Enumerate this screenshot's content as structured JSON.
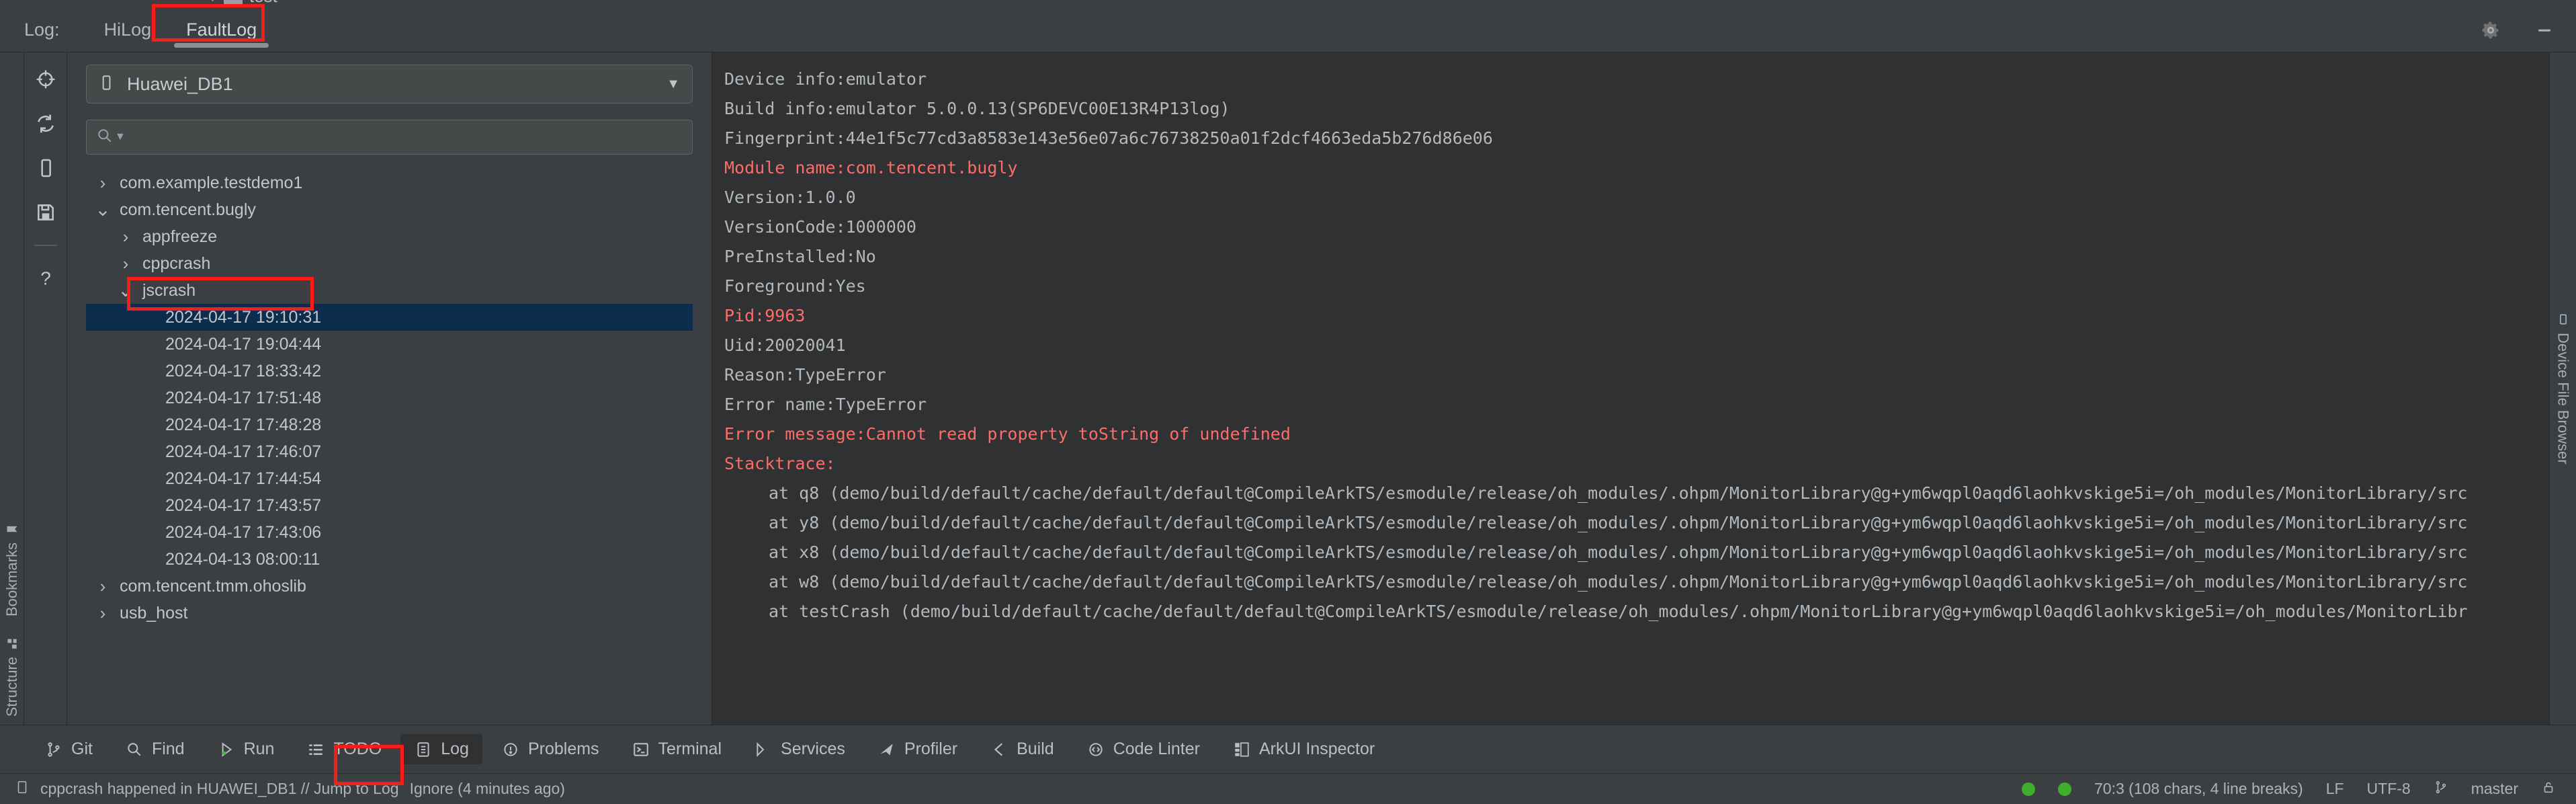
{
  "window": {
    "editor_tab_remnant": "test"
  },
  "log_header": {
    "label": "Log:",
    "tabs": [
      {
        "label": "HiLog",
        "active": false
      },
      {
        "label": "FaultLog",
        "active": true
      }
    ],
    "icons": {
      "settings": "gear-icon",
      "minimize": "minimize-icon"
    }
  },
  "left_rail": {
    "items": [
      {
        "label": "Bookmarks",
        "icon": "bookmark-icon"
      },
      {
        "label": "Structure",
        "icon": "structure-icon"
      }
    ]
  },
  "right_rail": {
    "items": [
      {
        "label": "Device File Browser",
        "icon": "device-icon"
      }
    ]
  },
  "tool_column": {
    "icons": [
      "crosshair-icon",
      "refresh-icon",
      "phone-icon",
      "save-icon",
      "help-icon"
    ]
  },
  "tree_panel": {
    "device": {
      "value": "Huawei_DB1",
      "icon": "phone-icon",
      "caret": "chevron-down-icon"
    },
    "search": {
      "value": "",
      "placeholder": "",
      "icon": "search-icon"
    },
    "rows": [
      {
        "label": "com.example.testdemo1",
        "depth": 0,
        "twisty": "collapsed",
        "selected": false
      },
      {
        "label": "com.tencent.bugly",
        "depth": 0,
        "twisty": "expanded",
        "selected": false
      },
      {
        "label": "appfreeze",
        "depth": 1,
        "twisty": "collapsed",
        "selected": false
      },
      {
        "label": "cppcrash",
        "depth": 1,
        "twisty": "collapsed",
        "selected": false
      },
      {
        "label": "jscrash",
        "depth": 1,
        "twisty": "expanded",
        "selected": false
      },
      {
        "label": "2024-04-17 19:10:31",
        "depth": 2,
        "twisty": "none",
        "selected": true
      },
      {
        "label": "2024-04-17 19:04:44",
        "depth": 2,
        "twisty": "none",
        "selected": false
      },
      {
        "label": "2024-04-17 18:33:42",
        "depth": 2,
        "twisty": "none",
        "selected": false
      },
      {
        "label": "2024-04-17 17:51:48",
        "depth": 2,
        "twisty": "none",
        "selected": false
      },
      {
        "label": "2024-04-17 17:48:28",
        "depth": 2,
        "twisty": "none",
        "selected": false
      },
      {
        "label": "2024-04-17 17:46:07",
        "depth": 2,
        "twisty": "none",
        "selected": false
      },
      {
        "label": "2024-04-17 17:44:54",
        "depth": 2,
        "twisty": "none",
        "selected": false
      },
      {
        "label": "2024-04-17 17:43:57",
        "depth": 2,
        "twisty": "none",
        "selected": false
      },
      {
        "label": "2024-04-17 17:43:06",
        "depth": 2,
        "twisty": "none",
        "selected": false
      },
      {
        "label": "2024-04-13 08:00:11",
        "depth": 2,
        "twisty": "none",
        "selected": false
      },
      {
        "label": "com.tencent.tmm.ohoslib",
        "depth": 0,
        "twisty": "collapsed",
        "selected": false
      },
      {
        "label": "usb_host",
        "depth": 0,
        "twisty": "collapsed",
        "selected": false
      }
    ]
  },
  "log_view": {
    "lines": [
      {
        "text": "Device info:emulator",
        "error": false,
        "indent": false
      },
      {
        "text": "Build info:emulator 5.0.0.13(SP6DEVC00E13R4P13log)",
        "error": false,
        "indent": false
      },
      {
        "text": "Fingerprint:44e1f5c77cd3a8583e143e56e07a6c76738250a01f2dcf4663eda5b276d86e06",
        "error": false,
        "indent": false
      },
      {
        "text": "Module name:com.tencent.bugly",
        "error": true,
        "indent": false
      },
      {
        "text": "Version:1.0.0",
        "error": false,
        "indent": false
      },
      {
        "text": "VersionCode:1000000",
        "error": false,
        "indent": false
      },
      {
        "text": "PreInstalled:No",
        "error": false,
        "indent": false
      },
      {
        "text": "Foreground:Yes",
        "error": false,
        "indent": false
      },
      {
        "text": "Pid:9963",
        "error": true,
        "indent": false
      },
      {
        "text": "Uid:20020041",
        "error": false,
        "indent": false
      },
      {
        "text": "Reason:TypeError",
        "error": false,
        "indent": false
      },
      {
        "text": "Error name:TypeError",
        "error": false,
        "indent": false
      },
      {
        "text": "Error message:Cannot read property toString of undefined",
        "error": true,
        "indent": false
      },
      {
        "text": "Stacktrace:",
        "error": true,
        "indent": false
      },
      {
        "text": "at q8 (demo/build/default/cache/default/default@CompileArkTS/esmodule/release/oh_modules/.ohpm/MonitorLibrary@g+ym6wqpl0aqd6laohkvskige5i=/oh_modules/MonitorLibrary/src",
        "error": false,
        "indent": true
      },
      {
        "text": "at y8 (demo/build/default/cache/default/default@CompileArkTS/esmodule/release/oh_modules/.ohpm/MonitorLibrary@g+ym6wqpl0aqd6laohkvskige5i=/oh_modules/MonitorLibrary/src",
        "error": false,
        "indent": true
      },
      {
        "text": "at x8 (demo/build/default/cache/default/default@CompileArkTS/esmodule/release/oh_modules/.ohpm/MonitorLibrary@g+ym6wqpl0aqd6laohkvskige5i=/oh_modules/MonitorLibrary/src",
        "error": false,
        "indent": true
      },
      {
        "text": "at w8 (demo/build/default/cache/default/default@CompileArkTS/esmodule/release/oh_modules/.ohpm/MonitorLibrary@g+ym6wqpl0aqd6laohkvskige5i=/oh_modules/MonitorLibrary/src",
        "error": false,
        "indent": true
      },
      {
        "text": "at testCrash (demo/build/default/cache/default/default@CompileArkTS/esmodule/release/oh_modules/.ohpm/MonitorLibrary@g+ym6wqpl0aqd6laohkvskige5i=/oh_modules/MonitorLibr",
        "error": false,
        "indent": true
      }
    ]
  },
  "bottom_bar": {
    "buttons": [
      {
        "label": "Git",
        "icon": "git-branch-icon",
        "active": false
      },
      {
        "label": "Find",
        "icon": "search-icon",
        "active": false
      },
      {
        "label": "Run",
        "icon": "run-play-icon",
        "active": false
      },
      {
        "label": "TODO",
        "icon": "todo-list-icon",
        "active": false
      },
      {
        "label": "Log",
        "icon": "log-icon",
        "active": true
      },
      {
        "label": "Problems",
        "icon": "problems-icon",
        "active": false
      },
      {
        "label": "Terminal",
        "icon": "terminal-icon",
        "active": false
      },
      {
        "label": "Services",
        "icon": "services-icon",
        "active": false
      },
      {
        "label": "Profiler",
        "icon": "profiler-icon",
        "active": false
      },
      {
        "label": "Build",
        "icon": "build-icon",
        "active": false
      },
      {
        "label": "Code Linter",
        "icon": "code-linter-icon",
        "active": false
      },
      {
        "label": "ArkUI Inspector",
        "icon": "arkui-inspector-icon",
        "active": false
      }
    ]
  },
  "status_bar": {
    "message": "cppcrash happened in HUAWEI_DB1 // Jump to Log",
    "ignore": "Ignore (4 minutes ago)",
    "caret_position": "70:3 (108 chars, 4 line breaks)",
    "line_separator": "LF",
    "encoding": "UTF-8",
    "branch": "master",
    "icon": "log-doc-icon",
    "lock_icon": "lock-open-icon",
    "indicator_color": "#3fae2a"
  },
  "annotations": {
    "color": "#ff1a1a",
    "boxes": [
      "faultlog-tab",
      "selected-timestamp",
      "log-tool-button"
    ]
  }
}
